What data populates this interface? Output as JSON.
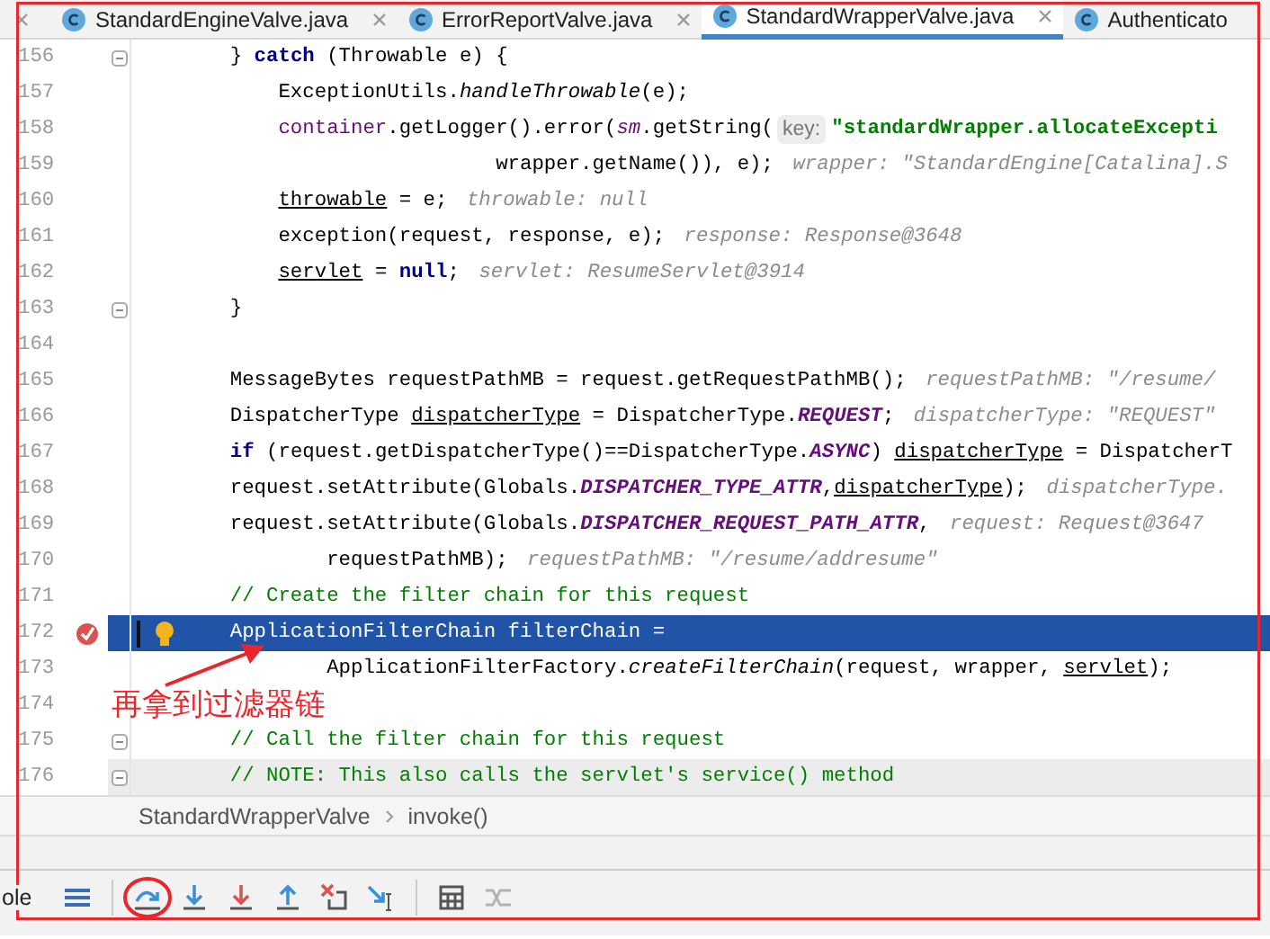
{
  "tabs": [
    {
      "label": "StandardEngineValve.java",
      "selected": false,
      "closable": true
    },
    {
      "label": "ErrorReportValve.java",
      "selected": false,
      "closable": true
    },
    {
      "label": "StandardWrapperValve.java",
      "selected": true,
      "closable": true
    },
    {
      "label": "Authenticato",
      "selected": false,
      "closable": false
    }
  ],
  "lines": [
    {
      "number": "156",
      "fold": true,
      "parts": [
        {
          "kind": "code",
          "segs": [
            {
              "t": "    } ",
              "kind": "plain"
            },
            {
              "t": "catch",
              "kind": "kw"
            },
            {
              "t": " (Throwable e) {",
              "kind": "plain"
            }
          ]
        }
      ]
    },
    {
      "number": "157",
      "parts": [
        {
          "kind": "code",
          "segs": [
            {
              "t": "        ExceptionUtils.",
              "kind": "plain"
            },
            {
              "t": "handleThrowable",
              "kind": "italic"
            },
            {
              "t": "(e);",
              "kind": "plain"
            }
          ]
        }
      ]
    },
    {
      "number": "158",
      "parts": [
        {
          "kind": "code",
          "segs": [
            {
              "t": "        container",
              "kind": "field"
            },
            {
              "t": ".getLogger().error(",
              "kind": "plain"
            },
            {
              "t": "sm",
              "kind": "static"
            },
            {
              "t": ".getString(",
              "kind": "plain"
            }
          ]
        },
        {
          "kind": "param",
          "text": "key:"
        },
        {
          "kind": "code",
          "segs": [
            {
              "t": "\"standardWrapper.allocateExcepti",
              "kind": "str"
            }
          ]
        }
      ]
    },
    {
      "number": "159",
      "parts": [
        {
          "kind": "code",
          "segs": [
            {
              "t": "                          wrapper.getName()), e);",
              "kind": "plain"
            }
          ]
        },
        {
          "kind": "hint",
          "text": "wrapper: \"StandardEngine[Catalina].S"
        }
      ]
    },
    {
      "number": "160",
      "parts": [
        {
          "kind": "code",
          "segs": [
            {
              "t": "        throwable",
              "kind": "under"
            },
            {
              "t": " = e;",
              "kind": "plain"
            }
          ]
        },
        {
          "kind": "hint",
          "text": "throwable: null"
        }
      ]
    },
    {
      "number": "161",
      "parts": [
        {
          "kind": "code",
          "segs": [
            {
              "t": "        exception(request, response, e);",
              "kind": "plain"
            }
          ]
        },
        {
          "kind": "hint",
          "text": "response: Response@3648"
        }
      ]
    },
    {
      "number": "162",
      "parts": [
        {
          "kind": "code",
          "segs": [
            {
              "t": "        servlet",
              "kind": "under"
            },
            {
              "t": " = ",
              "kind": "plain"
            },
            {
              "t": "null",
              "kind": "kw"
            },
            {
              "t": ";",
              "kind": "plain"
            }
          ]
        },
        {
          "kind": "hint",
          "text": "servlet: ResumeServlet@3914"
        }
      ]
    },
    {
      "number": "163",
      "fold": true,
      "parts": [
        {
          "kind": "code",
          "segs": [
            {
              "t": "    }",
              "kind": "plain"
            }
          ]
        }
      ]
    },
    {
      "number": "164"
    },
    {
      "number": "165",
      "parts": [
        {
          "kind": "code",
          "segs": [
            {
              "t": "    MessageBytes requestPathMB = request.getRequestPathMB();",
              "kind": "plain"
            }
          ]
        },
        {
          "kind": "hint",
          "text": "requestPathMB: \"/resume/"
        }
      ]
    },
    {
      "number": "166",
      "parts": [
        {
          "kind": "code",
          "segs": [
            {
              "t": "    DispatcherType ",
              "kind": "plain"
            },
            {
              "t": "dispatcherType",
              "kind": "under"
            },
            {
              "t": " = DispatcherType.",
              "kind": "plain"
            },
            {
              "t": "REQUEST",
              "kind": "const"
            },
            {
              "t": ";",
              "kind": "plain"
            }
          ]
        },
        {
          "kind": "hint",
          "text": "dispatcherType: \"REQUEST\""
        }
      ]
    },
    {
      "number": "167",
      "parts": [
        {
          "kind": "code",
          "segs": [
            {
              "t": "    if",
              "kind": "kw"
            },
            {
              "t": " (request.getDispatcherType()==DispatcherType.",
              "kind": "plain"
            },
            {
              "t": "ASYNC",
              "kind": "const"
            },
            {
              "t": ") ",
              "kind": "plain"
            },
            {
              "t": "dispatcherType",
              "kind": "under"
            },
            {
              "t": " = DispatcherT",
              "kind": "plain"
            }
          ]
        }
      ]
    },
    {
      "number": "168",
      "parts": [
        {
          "kind": "code",
          "segs": [
            {
              "t": "    request.setAttribute(Globals.",
              "kind": "plain"
            },
            {
              "t": "DISPATCHER_TYPE_ATTR",
              "kind": "const"
            },
            {
              "t": ",",
              "kind": "plain"
            },
            {
              "t": "dispatcherType",
              "kind": "under"
            },
            {
              "t": ");",
              "kind": "plain"
            }
          ]
        },
        {
          "kind": "hint",
          "text": "dispatcherType."
        }
      ]
    },
    {
      "number": "169",
      "parts": [
        {
          "kind": "code",
          "segs": [
            {
              "t": "    request.setAttribute(Globals.",
              "kind": "plain"
            },
            {
              "t": "DISPATCHER_REQUEST_PATH_ATTR",
              "kind": "const"
            },
            {
              "t": ",",
              "kind": "plain"
            }
          ]
        },
        {
          "kind": "hint",
          "text": "request: Request@3647"
        }
      ]
    },
    {
      "number": "170",
      "parts": [
        {
          "kind": "code",
          "segs": [
            {
              "t": "            requestPathMB);",
              "kind": "plain"
            }
          ]
        },
        {
          "kind": "hint",
          "text": "requestPathMB: \"/resume/addresume\""
        }
      ]
    },
    {
      "number": "171",
      "parts": [
        {
          "kind": "code",
          "segs": [
            {
              "t": "    // Create the filter chain for this request",
              "kind": "comment"
            }
          ]
        }
      ]
    },
    {
      "number": "172",
      "highlighted": true,
      "breakpoint": true,
      "bulb": true,
      "parts": [
        {
          "kind": "code",
          "segs": [
            {
              "t": "    ApplicationFilterChain filterChain =",
              "kind": "plain"
            }
          ]
        }
      ]
    },
    {
      "number": "173",
      "parts": [
        {
          "kind": "code",
          "segs": [
            {
              "t": "            ApplicationFilterFactory.",
              "kind": "plain"
            },
            {
              "t": "createFilterChain",
              "kind": "italic"
            },
            {
              "t": "(request, wrapper, ",
              "kind": "plain"
            },
            {
              "t": "servlet",
              "kind": "under"
            },
            {
              "t": ");",
              "kind": "plain"
            }
          ]
        }
      ]
    },
    {
      "number": "174"
    },
    {
      "number": "175",
      "fold": true,
      "parts": [
        {
          "kind": "code",
          "segs": [
            {
              "t": "    // Call the filter chain for this request",
              "kind": "comment"
            }
          ]
        }
      ]
    },
    {
      "number": "176",
      "fold": true,
      "current_line": true,
      "parts": [
        {
          "kind": "code",
          "segs": [
            {
              "t": "    // NOTE: This also calls the servlet's service() method",
              "kind": "comment"
            }
          ]
        }
      ]
    }
  ],
  "breadcrumb": [
    "StandardWrapperValve",
    "invoke()"
  ],
  "toolbar": {
    "label": "ole",
    "buttons": [
      {
        "kind": "list",
        "disabled": false,
        "circled": false
      },
      {
        "kind": "step-over",
        "disabled": false,
        "circled": true
      },
      {
        "kind": "step-into",
        "disabled": false,
        "circled": false
      },
      {
        "kind": "force-step-into",
        "disabled": false,
        "circled": false
      },
      {
        "kind": "step-out",
        "disabled": false,
        "circled": false
      },
      {
        "kind": "drop-frame",
        "disabled": false,
        "circled": false
      },
      {
        "kind": "run-to-cursor",
        "disabled": false,
        "circled": false
      },
      {
        "kind": "evaluate",
        "disabled": false,
        "circled": false
      },
      {
        "kind": "trace",
        "disabled": true,
        "circled": false
      }
    ]
  },
  "annotation": {
    "text": "再拿到过滤器链"
  }
}
